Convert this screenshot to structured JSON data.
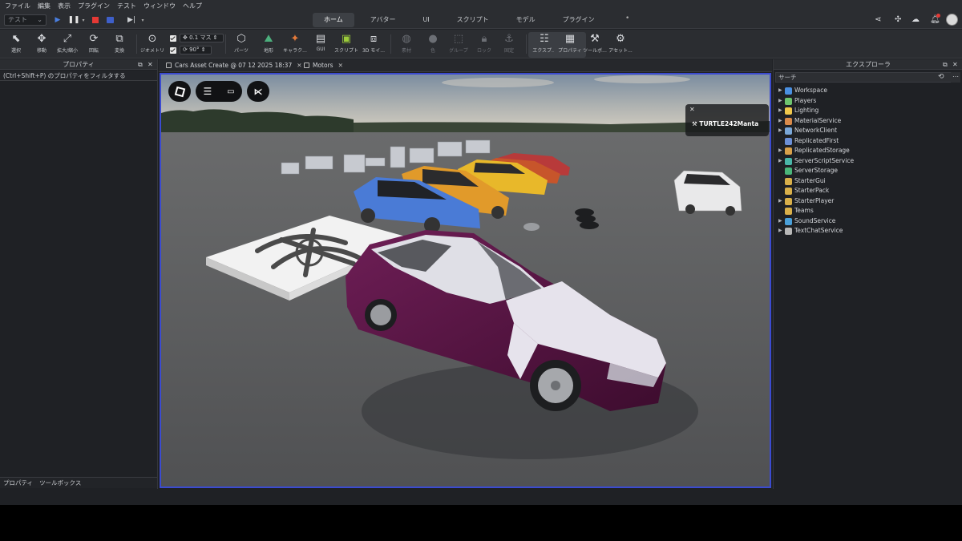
{
  "menubar": {
    "items": [
      "ファイル",
      "編集",
      "表示",
      "プラグイン",
      "テスト",
      "ウィンドウ",
      "ヘルプ"
    ]
  },
  "toolbar": {
    "test_mode": "テスト",
    "mode_tabs": [
      "ホーム",
      "アバター",
      "UI",
      "スクリプト",
      "モデル",
      "プラグイン"
    ],
    "active_tab": "ホーム"
  },
  "ribbon": {
    "tools": [
      {
        "label": "選択",
        "icon": "cursor-icon"
      },
      {
        "label": "移動",
        "icon": "move-icon"
      },
      {
        "label": "拡大/縮小",
        "icon": "scale-icon"
      },
      {
        "label": "回転",
        "icon": "rotate-icon"
      },
      {
        "label": "変換",
        "icon": "transform-icon"
      }
    ],
    "geometry_label": "ジオメトリ",
    "move_snap": "0.1 マス",
    "rotate_snap": "90°",
    "insert": [
      {
        "label": "パーツ",
        "icon": "part-icon"
      },
      {
        "label": "地形",
        "icon": "terrain-icon"
      },
      {
        "label": "キャラク...",
        "icon": "character-icon"
      },
      {
        "label": "GUI",
        "icon": "gui-icon"
      },
      {
        "label": "スクリプト",
        "icon": "script-icon"
      },
      {
        "label": "3D モイ...",
        "icon": "3d-icon"
      }
    ],
    "edit": [
      {
        "label": "素材",
        "icon": "material-icon"
      },
      {
        "label": "色",
        "icon": "color-icon"
      },
      {
        "label": "グループ",
        "icon": "group-icon"
      },
      {
        "label": "ロック",
        "icon": "lock-icon"
      },
      {
        "label": "固定",
        "icon": "anchor-icon"
      }
    ],
    "windows": [
      {
        "label": "エクスプ...",
        "icon": "explorer-icon"
      },
      {
        "label": "プロパティ",
        "icon": "properties-icon"
      },
      {
        "label": "ツールボ...",
        "icon": "toolbox-icon"
      },
      {
        "label": "アセット...",
        "icon": "asset-icon"
      }
    ]
  },
  "properties": {
    "title": "プロパティ",
    "filter_placeholder": "(Ctrl+Shift+P) のプロパティをフィルタする",
    "bottom_tabs": [
      "プロパティ",
      "ツールボックス"
    ]
  },
  "documents": {
    "tabs": [
      "Cars Asset Create @ 07 12 2025 18:37",
      "Motors"
    ]
  },
  "viewport": {
    "player_name": "TURTLE242Manta"
  },
  "explorer": {
    "title": "エクスプローラ",
    "search_placeholder": "サーチ",
    "items": [
      {
        "name": "Workspace",
        "expandable": true,
        "color": "#4a90e2"
      },
      {
        "name": "Players",
        "expandable": true,
        "color": "#6ec46e"
      },
      {
        "name": "Lighting",
        "expandable": true,
        "color": "#f1c84b"
      },
      {
        "name": "MaterialService",
        "expandable": true,
        "color": "#d98a4a"
      },
      {
        "name": "NetworkClient",
        "expandable": true,
        "color": "#7aa7d8"
      },
      {
        "name": "ReplicatedFirst",
        "expandable": false,
        "color": "#6b8fd6"
      },
      {
        "name": "ReplicatedStorage",
        "expandable": true,
        "color": "#d9a14a"
      },
      {
        "name": "ServerScriptService",
        "expandable": true,
        "color": "#4ab6a8"
      },
      {
        "name": "ServerStorage",
        "expandable": false,
        "color": "#4ab67a"
      },
      {
        "name": "StarterGui",
        "expandable": false,
        "color": "#d9b04a"
      },
      {
        "name": "StarterPack",
        "expandable": false,
        "color": "#d9b04a"
      },
      {
        "name": "StarterPlayer",
        "expandable": true,
        "color": "#d9b04a"
      },
      {
        "name": "Teams",
        "expandable": false,
        "color": "#d9b04a"
      },
      {
        "name": "SoundService",
        "expandable": true,
        "color": "#4aa0d9"
      },
      {
        "name": "TextChatService",
        "expandable": true,
        "color": "#b8b8b8"
      }
    ]
  }
}
